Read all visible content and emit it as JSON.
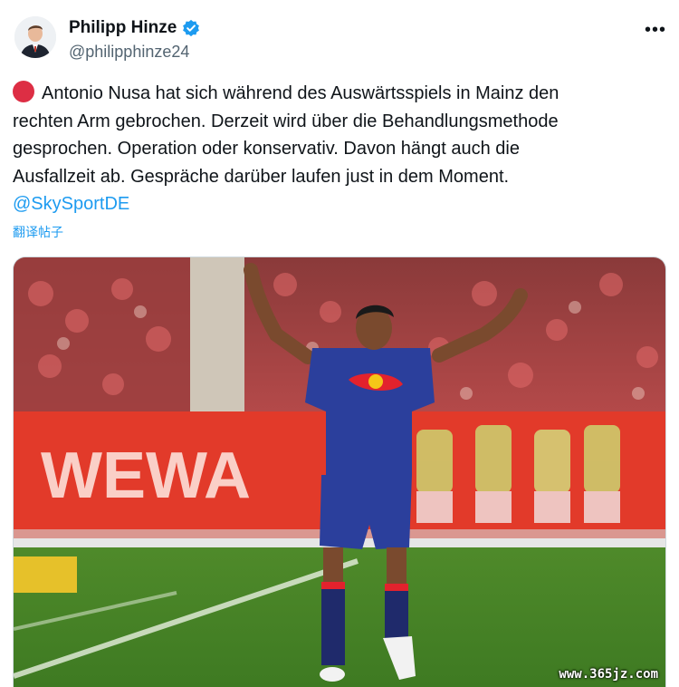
{
  "author": {
    "name": "Philipp Hinze",
    "handle": "@philipphinze24",
    "verified": true,
    "avatar_icon": "person-avatar"
  },
  "more_label": "•••",
  "tweet": {
    "emoji_icon": "red-circle-icon",
    "lines": [
      "Antonio Nusa hat sich während des Auswärtsspiels in Mainz den",
      "rechten Arm gebrochen. Derzeit wird über die Behandlungsmethode",
      "gesprochen. Operation oder konservativ. Davon hängt auch die",
      "Ausfallzeit ab. Gespräche darüber laufen just in dem Moment."
    ],
    "mention": "@SkySportDE",
    "translate_label": "翻译帖子"
  },
  "media": {
    "banner_text": "WEWA",
    "watermark": "www.365jz.com"
  },
  "colors": {
    "link": "#1d9bf0",
    "verified": "#1d9bf0",
    "emoji_red": "#dd2e44",
    "text": "#0f1419",
    "secondary": "#536471"
  }
}
